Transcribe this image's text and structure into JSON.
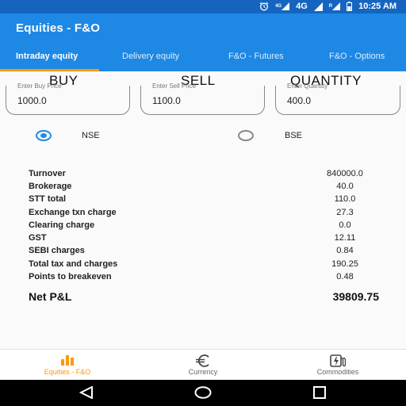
{
  "status_bar": {
    "network_label": "4G",
    "network_label_small": "4G",
    "roaming_label": "R",
    "time": "10:25 AM"
  },
  "app_bar": {
    "title": "Equities - F&O"
  },
  "tabs": [
    {
      "label": "Intraday equity",
      "active": true
    },
    {
      "label": "Delivery equity",
      "active": false
    },
    {
      "label": "F&O - Futures",
      "active": false
    },
    {
      "label": "F&O - Options",
      "active": false
    }
  ],
  "inputs": {
    "buy": {
      "heading": "BUY",
      "placeholder": "Enter Buy Price",
      "value": "1000.0"
    },
    "sell": {
      "heading": "SELL",
      "placeholder": "Enter Sell Price",
      "value": "1100.0"
    },
    "quantity": {
      "heading": "QUANTITY",
      "placeholder": "Enter Quantity",
      "value": "400.0"
    }
  },
  "exchange": {
    "nse_label": "NSE",
    "bse_label": "BSE",
    "selected": "NSE"
  },
  "results": [
    {
      "label": "Turnover",
      "value": "840000.0"
    },
    {
      "label": "Brokerage",
      "value": "40.0"
    },
    {
      "label": "STT total",
      "value": "110.0"
    },
    {
      "label": "Exchange txn charge",
      "value": "27.3"
    },
    {
      "label": "Clearing charge",
      "value": "0.0"
    },
    {
      "label": "GST",
      "value": "12.11"
    },
    {
      "label": "SEBI charges",
      "value": "0.84"
    },
    {
      "label": "Total tax and charges",
      "value": "190.25"
    },
    {
      "label": "Points to breakeven",
      "value": "0.48"
    }
  ],
  "net_pl": {
    "label": "Net P&L",
    "value": "39809.75"
  },
  "bottom_nav": [
    {
      "label": "Equities - F&O",
      "icon": "bar-chart-icon",
      "active": true
    },
    {
      "label": "Currency",
      "icon": "euro-icon",
      "active": false
    },
    {
      "label": "Commodities",
      "icon": "fuel-icon",
      "active": false
    }
  ],
  "colors": {
    "status_bar": "#1565c0",
    "app_bar": "#1e88e5",
    "accent": "#ff9800"
  }
}
